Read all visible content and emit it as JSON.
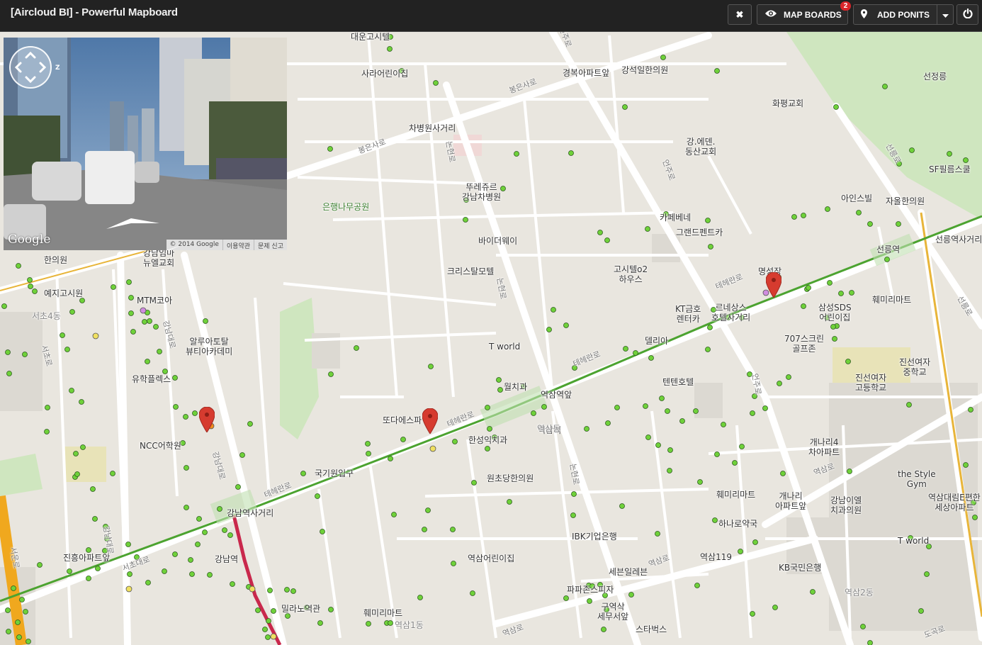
{
  "app": {
    "title": "[Aircloud BI] - Powerful Mapboard"
  },
  "toolbar": {
    "close_glyph": "✖",
    "map_boards_label": "MAP BOARDS",
    "map_boards_badge": "2",
    "add_points_label": "ADD PONITS",
    "power_glyph": "⏻",
    "icons": [
      "close-icon",
      "eye-icon",
      "map-marker-icon",
      "caret-down-icon",
      "power-icon"
    ]
  },
  "street_view": {
    "brand": "Google",
    "copyright": "© 2014 Google",
    "terms": "이용약관",
    "report": "문제 신고",
    "icons": [
      "pan-control-icon",
      "compass-icon",
      "nav-arrow-icon"
    ]
  },
  "map": {
    "places": [
      {
        "text": "한의원"
      },
      {
        "text": "예지고시원"
      },
      {
        "text": "MTM코아"
      },
      {
        "text": "알루아토탈\n뷰티아카데미"
      },
      {
        "text": "유학플렉스"
      },
      {
        "text": "NCC어학원"
      },
      {
        "text": "강남역사거리"
      },
      {
        "text": "진흥아파트앞"
      },
      {
        "text": "강남역"
      },
      {
        "text": "밀라노역관"
      },
      {
        "text": "훼미리마트"
      },
      {
        "text": "역삼어린이집"
      },
      {
        "text": "국기원입구"
      },
      {
        "text": "또다에스파"
      },
      {
        "text": "한성익치과"
      },
      {
        "text": "원초당한의원"
      },
      {
        "text": "IBK기업은행"
      },
      {
        "text": "세븐일레븐"
      },
      {
        "text": "파파존스피자"
      },
      {
        "text": "구역삭\n세무서앞"
      },
      {
        "text": "스타벅스"
      },
      {
        "text": "역삼119"
      },
      {
        "text": "KB국민은행"
      },
      {
        "text": "하나로약국"
      },
      {
        "text": "훼미리마트"
      },
      {
        "text": "개나리\n아파트앞"
      },
      {
        "text": "강남이엘\n치과의원"
      },
      {
        "text": "역삼대림E편한\n세상아파트"
      },
      {
        "text": "T world"
      },
      {
        "text": "the Style\nGym"
      },
      {
        "text": "개나리4\n차아파트"
      },
      {
        "text": "진선여자\n고등학교"
      },
      {
        "text": "진선여자\n중학교"
      },
      {
        "text": "707스크린\n골프존"
      },
      {
        "text": "삼성SDS\n어린이집"
      },
      {
        "text": "훼미리마트"
      },
      {
        "text": "명성장"
      },
      {
        "text": "선릉역"
      },
      {
        "text": "선릉역사거리"
      },
      {
        "text": "르네상스\n호텔사거리"
      },
      {
        "text": "KT금호\n렌터카"
      },
      {
        "text": "델리아"
      },
      {
        "text": "텐텐호텔"
      },
      {
        "text": "월치과"
      },
      {
        "text": "역삼역앞"
      },
      {
        "text": "역삼역"
      },
      {
        "text": "T world"
      },
      {
        "text": "고시텔o2\n하우스"
      },
      {
        "text": "크리스탈모텔"
      },
      {
        "text": "바이더웨이"
      },
      {
        "text": "뚜레쥬르\n강남차병원"
      },
      {
        "text": "차병원사거리"
      },
      {
        "text": "사라어린이집"
      },
      {
        "text": "대운고시텔"
      },
      {
        "text": "경복아파트앞"
      },
      {
        "text": "강석일한의원"
      },
      {
        "text": "화평교회"
      },
      {
        "text": "강.에덴.\n동산교회"
      },
      {
        "text": "카페베네"
      },
      {
        "text": "그랜드펜트카"
      },
      {
        "text": "아인스빌"
      },
      {
        "text": "자올한의원"
      },
      {
        "text": "SF필름스쿨"
      },
      {
        "text": "선정릉"
      },
      {
        "text": "강남임마\n뉴엘교회"
      }
    ],
    "green_labels": [
      {
        "text": "은행나무공원"
      }
    ],
    "roads": [
      {
        "text": "봉은사로"
      },
      {
        "text": "봉은사로"
      },
      {
        "text": "논현로"
      },
      {
        "text": "논현로"
      },
      {
        "text": "언주로"
      },
      {
        "text": "언주로"
      },
      {
        "text": "테헤란로"
      },
      {
        "text": "테헤란로"
      },
      {
        "text": "테헤란로"
      },
      {
        "text": "테헤란로"
      },
      {
        "text": "강남대로"
      },
      {
        "text": "강남대로"
      },
      {
        "text": "서초대로"
      },
      {
        "text": "서초로"
      },
      {
        "text": "서운로"
      },
      {
        "text": "역삼로"
      },
      {
        "text": "역삼로"
      },
      {
        "text": "역삼로"
      },
      {
        "text": "선릉로"
      },
      {
        "text": "선릉로"
      },
      {
        "text": "도곡로"
      },
      {
        "text": "언주로"
      },
      {
        "text": "논현로"
      },
      {
        "text": "강남대로"
      }
    ],
    "dongs": [
      {
        "text": "서초4동"
      },
      {
        "text": "역삼동"
      },
      {
        "text": "역삼1동"
      },
      {
        "text": "역삼2동"
      }
    ],
    "marker_colors": {
      "green": "#6fd13a",
      "pink": "#d08ce0",
      "orange": "#f08c1e",
      "yellow": "#f0e060",
      "pin": "#d63b2f",
      "subway_green": "#4ca330"
    }
  }
}
